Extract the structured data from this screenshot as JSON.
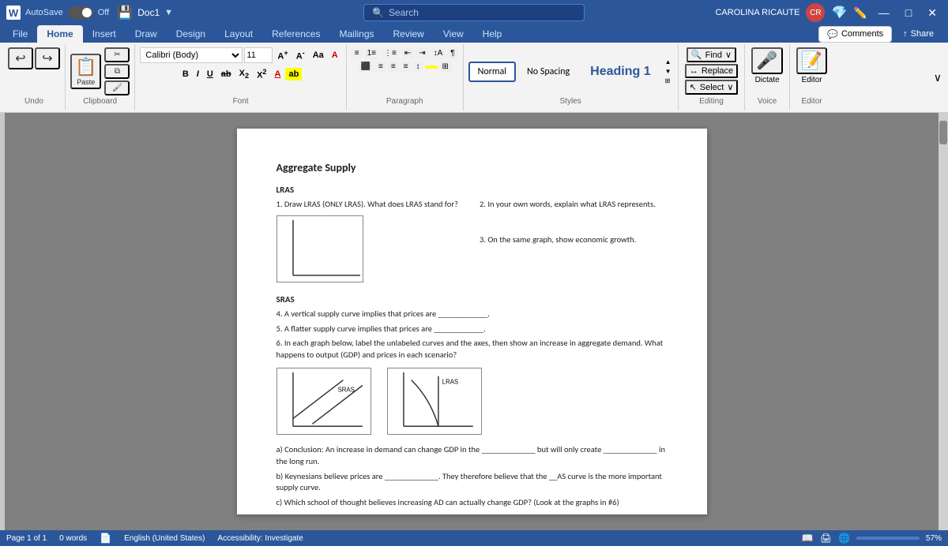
{
  "titlebar": {
    "word_icon": "W",
    "autosave": "AutoSave",
    "toggle_state": "Off",
    "doc_title": "Doc1",
    "search_placeholder": "Search",
    "user_name": "CAROLINA RICAUTE",
    "min_btn": "—",
    "restore_btn": "□",
    "close_btn": "✕"
  },
  "ribbon": {
    "tabs": [
      "File",
      "Home",
      "Insert",
      "Draw",
      "Design",
      "Layout",
      "References",
      "Mailings",
      "Review",
      "View",
      "Help"
    ],
    "active_tab": "Home",
    "clipboard": {
      "label": "Clipboard",
      "paste": "Paste",
      "cut": "✂",
      "copy": "⧉",
      "format_painter": "🖌"
    },
    "font": {
      "label": "Font",
      "font_name": "Calibri (Body)",
      "font_size": "11",
      "grow": "A↑",
      "shrink": "A↓",
      "case": "Aa",
      "clear": "A",
      "bold": "B",
      "italic": "I",
      "underline": "U",
      "strikethrough": "ab",
      "subscript": "X₂",
      "superscript": "X²",
      "font_color": "A",
      "highlight": "ab"
    },
    "paragraph": {
      "label": "Paragraph"
    },
    "styles": {
      "label": "Styles",
      "items": [
        {
          "id": "normal",
          "label": "Normal"
        },
        {
          "id": "no-spacing",
          "label": "No Spacing"
        },
        {
          "id": "heading1",
          "label": "Heading 1"
        }
      ],
      "active": "normal"
    },
    "editing": {
      "label": "Editing",
      "find": "Find",
      "replace": "Replace",
      "select": "Select"
    },
    "voice": {
      "label": "Voice",
      "dictate": "Dictate"
    },
    "editor": {
      "label": "Editor",
      "editor": "Editor"
    },
    "comments_btn": "Comments",
    "share_btn": "Share"
  },
  "document": {
    "content": {
      "title": "Aggregate Supply",
      "sections": [
        {
          "id": "lras",
          "label": "LRAS",
          "questions": [
            "1. Draw LRAS (ONLY LRAS). What does LRAS stand for?",
            "2. In your own words, explain what LRAS represents.",
            "3. On the same graph, show economic growth."
          ]
        },
        {
          "id": "sras",
          "label": "SRAS",
          "questions": [
            "4. A vertical supply curve implies that prices are ____________.",
            "5. A flatter supply curve implies that prices are ____________.",
            "6. In each graph below, label the unlabeled curves and the axes, then show an increase in aggregate demand. What happens to output (GDP) and prices in each scenario?"
          ]
        }
      ],
      "graph_labels": {
        "sras": "SRAS",
        "lras": "LRAS"
      },
      "conclusion": {
        "a": "a)   Conclusion: An increase in demand can change GDP in the _____________ but will only create _____________ in the long run.",
        "b": "b)   Keynesians believe prices are _____________. They therefore believe that the __AS curve is the more important supply curve.",
        "c": "c)   Which school of thought believes increasing AD can actually change GDP? (Look at the graphs in #6)"
      }
    }
  },
  "statusbar": {
    "page": "Page 1 of 1",
    "words": "0 words",
    "language": "English (United States)",
    "accessibility": "Accessibility: Investigate",
    "zoom": "57%"
  }
}
